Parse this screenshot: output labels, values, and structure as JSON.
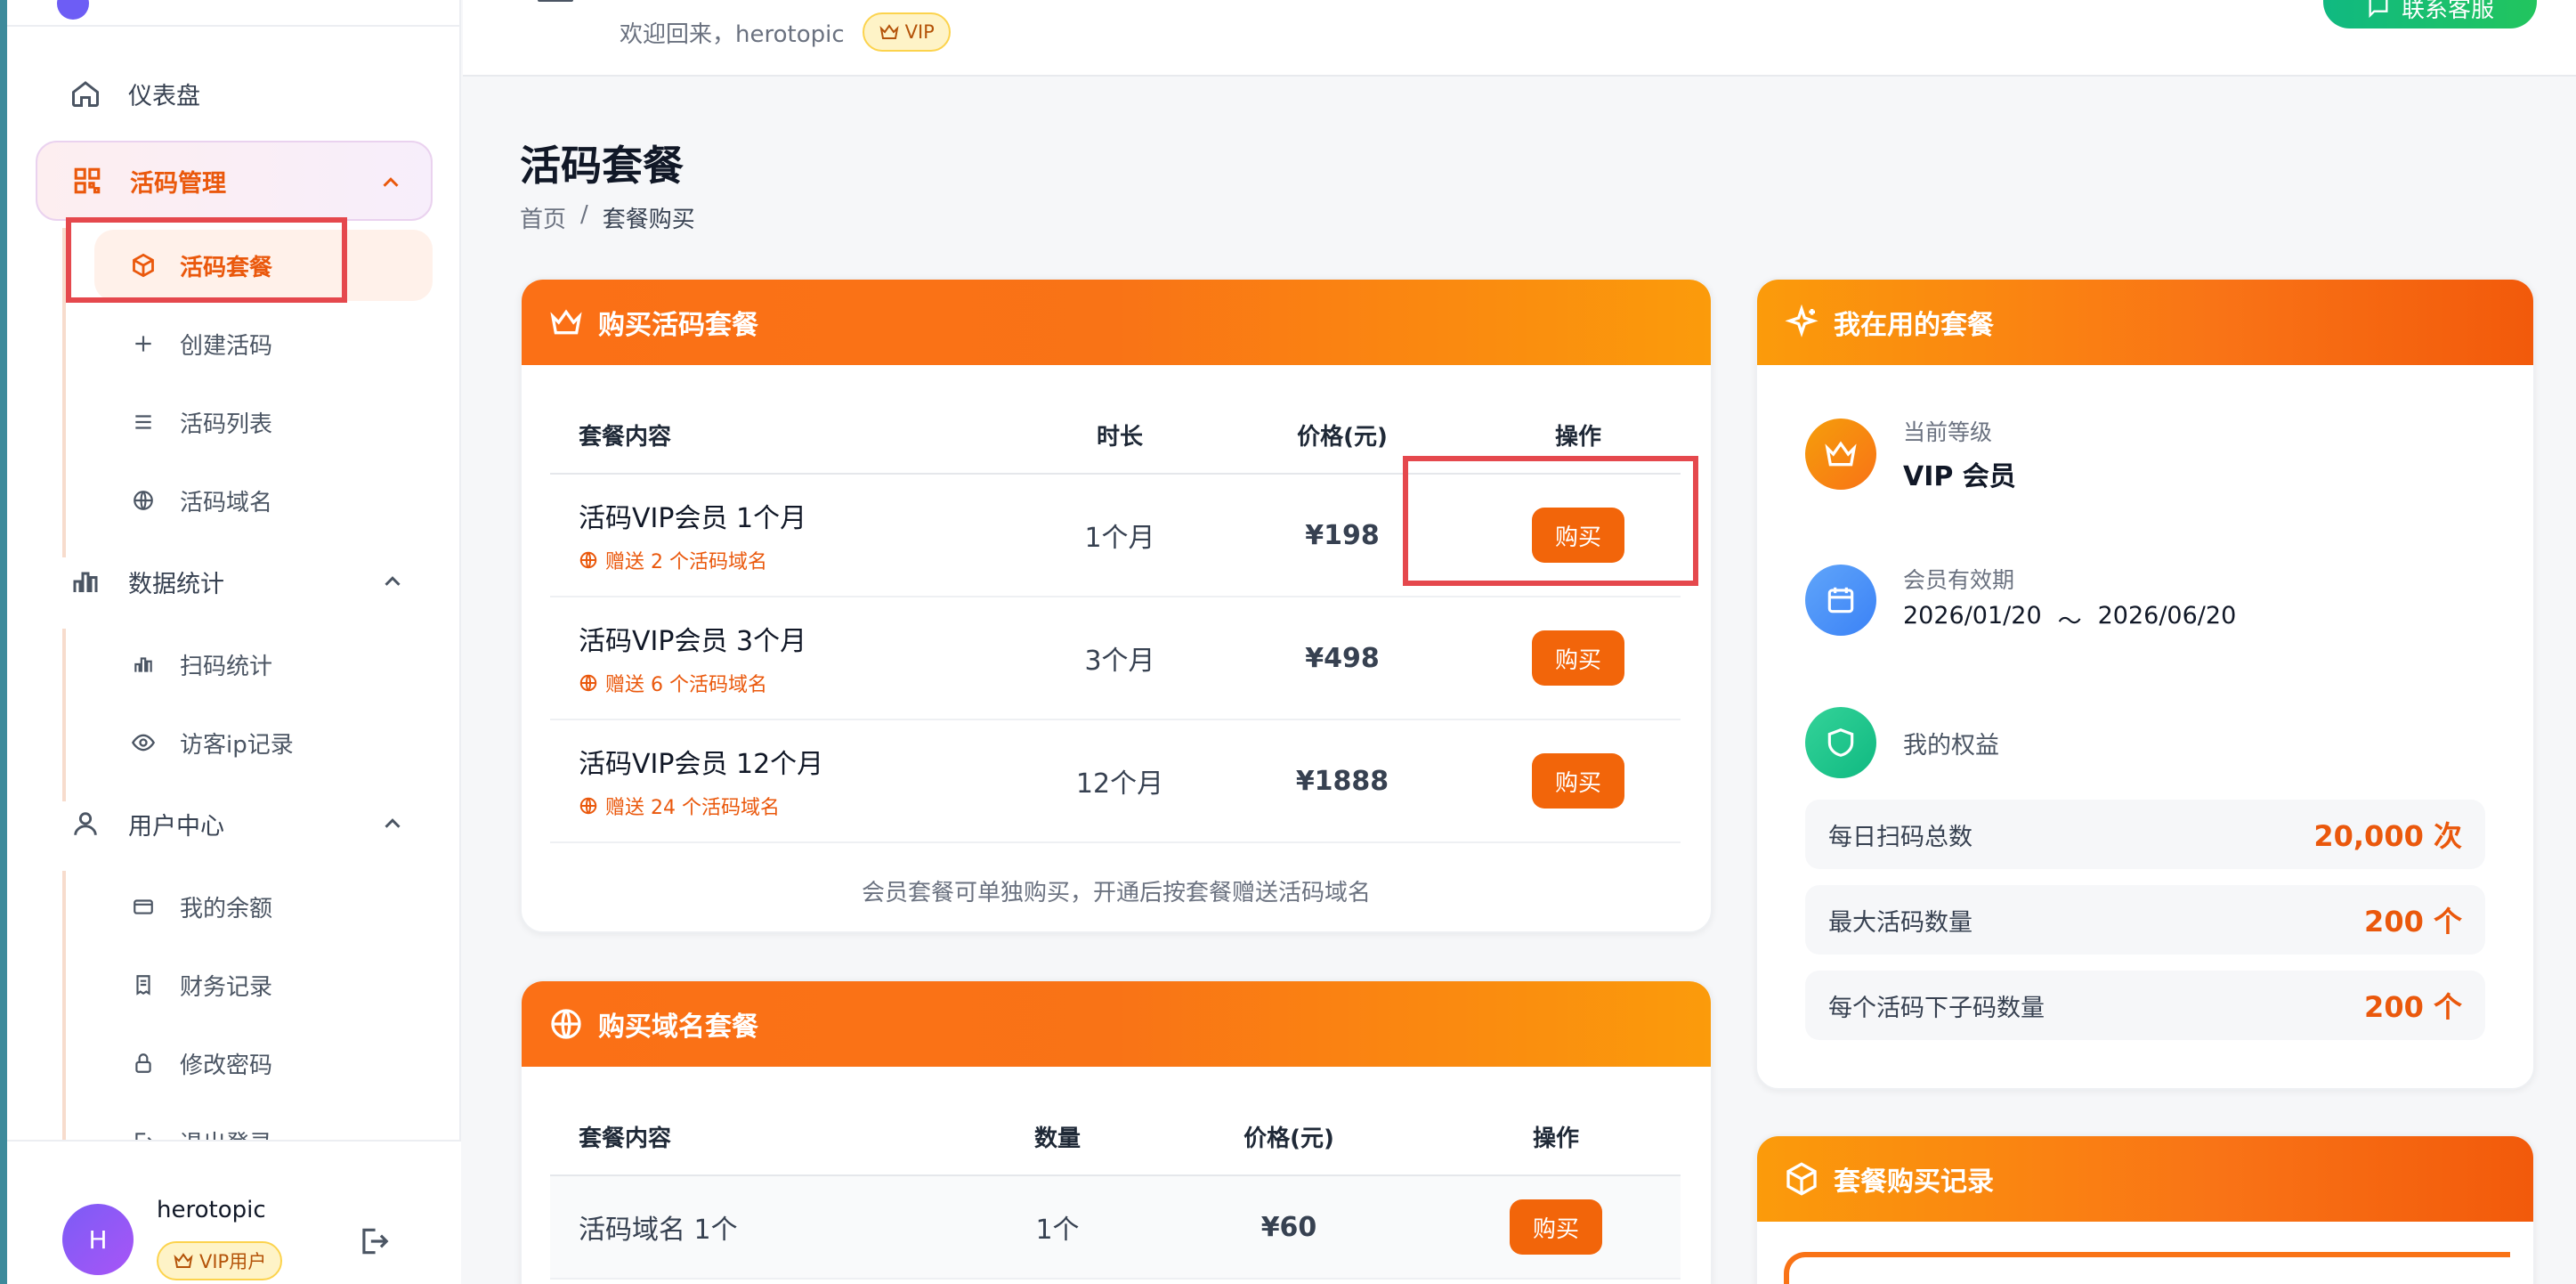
{
  "header": {
    "welcome": "欢迎回来，herotopic",
    "vip_badge": "VIP",
    "contact_button": "联系客服"
  },
  "sidebar": {
    "dashboard": "仪表盘",
    "code_mgmt": "活码管理",
    "code_mgmt_items": [
      "活码套餐",
      "创建活码",
      "活码列表",
      "活码域名"
    ],
    "stats": "数据统计",
    "stats_items": [
      "扫码统计",
      "访客ip记录"
    ],
    "user_center": "用户中心",
    "user_items": [
      "我的余额",
      "财务记录",
      "修改密码",
      "退出登录"
    ],
    "user": {
      "avatar_letter": "H",
      "name": "herotopic",
      "badge": "VIP用户"
    }
  },
  "page": {
    "title": "活码套餐",
    "breadcrumb": [
      "首页",
      "/",
      "套餐购买"
    ]
  },
  "code_packages": {
    "title": "购买活码套餐",
    "headers": [
      "套餐内容",
      "时长",
      "价格(元)",
      "操作"
    ],
    "rows": [
      {
        "name": "活码VIP会员 1个月",
        "gift": "赠送 2 个活码域名",
        "duration": "1个月",
        "price": "¥198",
        "action": "购买"
      },
      {
        "name": "活码VIP会员 3个月",
        "gift": "赠送 6 个活码域名",
        "duration": "3个月",
        "price": "¥498",
        "action": "购买"
      },
      {
        "name": "活码VIP会员 12个月",
        "gift": "赠送 24 个活码域名",
        "duration": "12个月",
        "price": "¥1888",
        "action": "购买"
      }
    ],
    "note": "会员套餐可单独购买，开通后按套餐赠送活码域名"
  },
  "domain_packages": {
    "title": "购买域名套餐",
    "headers": [
      "套餐内容",
      "数量",
      "价格(元)",
      "操作"
    ],
    "rows": [
      {
        "name": "活码域名 1个",
        "qty": "1个",
        "price": "¥60",
        "action": "购买"
      }
    ]
  },
  "my_package": {
    "title": "我在用的套餐",
    "level_label": "当前等级",
    "level_value": "VIP 会员",
    "period_label": "会员有效期",
    "period_start": "2026/01/20",
    "period_sep": "～",
    "period_end": "2026/06/20",
    "benefits_label": "我的权益",
    "benefits": [
      {
        "label": "每日扫码总数",
        "value": "20,000 次"
      },
      {
        "label": "最大活码数量",
        "value": "200 个"
      },
      {
        "label": "每个活码下子码数量",
        "value": "200 个"
      }
    ]
  },
  "purchase_records": {
    "title": "套餐购买记录"
  },
  "colors": {
    "accent": "#f97316",
    "danger_box": "#e5484d",
    "success": "#10b981",
    "brand_purple": "#7c5cf5"
  }
}
